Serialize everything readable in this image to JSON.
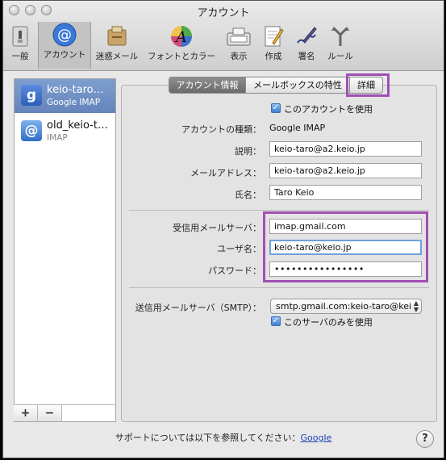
{
  "window": {
    "title": "アカウント"
  },
  "toolbar": {
    "items": [
      {
        "label": "一般",
        "icon": "switch-icon"
      },
      {
        "label": "アカウント",
        "icon": "at-icon"
      },
      {
        "label": "迷惑メール",
        "icon": "junk-mail-icon"
      },
      {
        "label": "フォントとカラー",
        "icon": "font-icon"
      },
      {
        "label": "表示",
        "icon": "view-icon"
      },
      {
        "label": "作成",
        "icon": "compose-icon"
      },
      {
        "label": "署名",
        "icon": "signature-icon"
      },
      {
        "label": "ルール",
        "icon": "rules-icon"
      }
    ]
  },
  "sidebar": {
    "accounts": [
      {
        "name": "keio-taro…",
        "type": "Google IMAP",
        "icon": "google-icon",
        "selected": true
      },
      {
        "name": "old_keio-t…",
        "type": "IMAP",
        "icon": "at-icon",
        "selected": false
      }
    ],
    "add_label": "+",
    "remove_label": "−"
  },
  "tabs": [
    {
      "label": "アカウント情報",
      "selected": true
    },
    {
      "label": "メールボックスの特性",
      "selected": false
    },
    {
      "label": "詳細",
      "selected": false
    }
  ],
  "account_info": {
    "enable_label": "このアカウントを使用",
    "enable_checked": true,
    "type_label": "アカウントの種類：",
    "type_value": "Google IMAP",
    "description_label": "説明：",
    "description_value": "keio-taro@a2.keio.jp",
    "email_label": "メールアドレス：",
    "email_value": "keio-taro@a2.keio.jp",
    "fullname_label": "氏名：",
    "fullname_value": "Taro Keio"
  },
  "incoming": {
    "server_label": "受信用メールサーバ：",
    "server_value": "imap.gmail.com",
    "username_label": "ユーザ名：",
    "username_value": "keio-taro@keio.jp",
    "password_label": "パスワード：",
    "password_value": "••••••••••••••••"
  },
  "outgoing": {
    "server_label": "送信用メールサーバ（SMTP）：",
    "server_value": "smtp.gmail.com:keio-taro@kei",
    "only_label": "このサーバのみを使用",
    "only_checked": true
  },
  "footer": {
    "support_text": "サポートについては以下を参照してください：",
    "support_link": "Google"
  },
  "help_label": "?",
  "colors": {
    "highlight": "#a14fb3",
    "selection": "#6c8cc3",
    "focus": "#6ea1dc",
    "link": "#1a3fb8"
  }
}
